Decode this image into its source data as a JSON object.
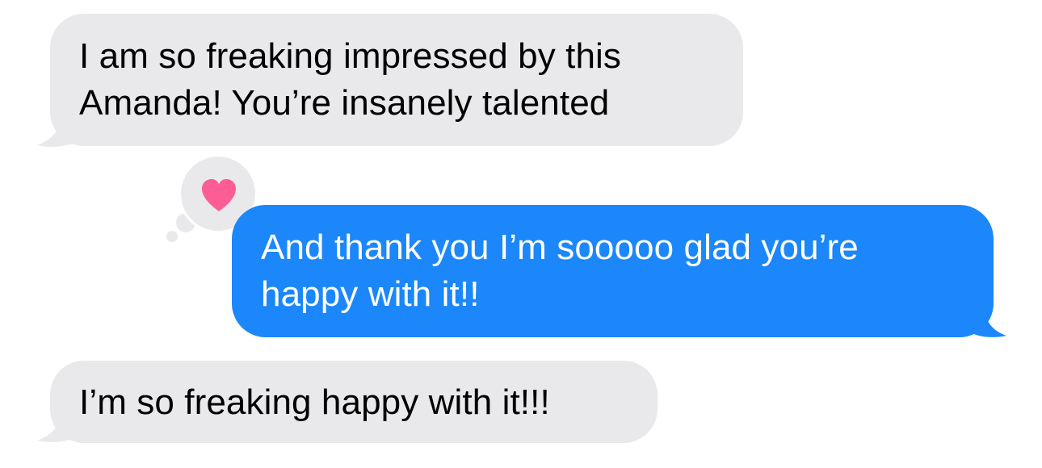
{
  "conversation": {
    "messages": [
      {
        "direction": "incoming",
        "text": "I am so freaking impressed by this\nAmanda! You’re insanely talented",
        "reaction": "heart"
      },
      {
        "direction": "outgoing",
        "text": "And thank you I’m sooooo glad you’re\nhappy with it!!"
      },
      {
        "direction": "incoming",
        "text": "I’m so freaking happy with it!!!"
      }
    ]
  },
  "reaction": {
    "icon": "heart-icon",
    "color": "#fd5c95"
  },
  "colors": {
    "incoming_bubble": "#e9e9eb",
    "outgoing_bubble": "#1b87fa",
    "incoming_text": "#000000",
    "outgoing_text": "#ffffff",
    "background": "#ffffff"
  }
}
